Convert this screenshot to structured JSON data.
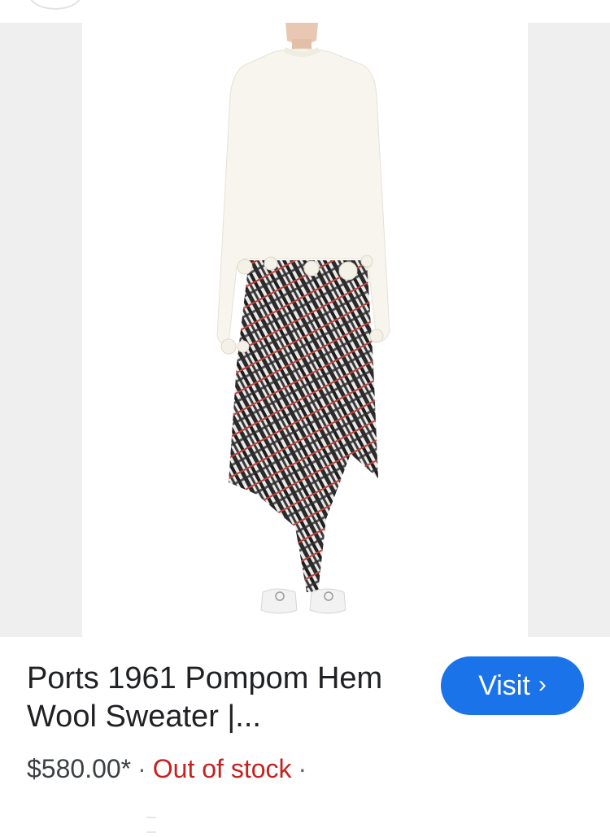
{
  "product": {
    "title": "Ports 1961 Pompom Hem Wool Sweater |...",
    "price": "$580.00*",
    "separator": "·",
    "stock_status": "Out of stock",
    "trailing_separator": "·",
    "image_alt": "Model wearing white pompom hem wool sweater with plaid asymmetric skirt"
  },
  "actions": {
    "visit_label": "Visit",
    "visit_chevron": "›"
  },
  "colors": {
    "visit_button": "#1a73e8",
    "out_of_stock": "#c5221f",
    "image_side_panel": "#efefef"
  }
}
